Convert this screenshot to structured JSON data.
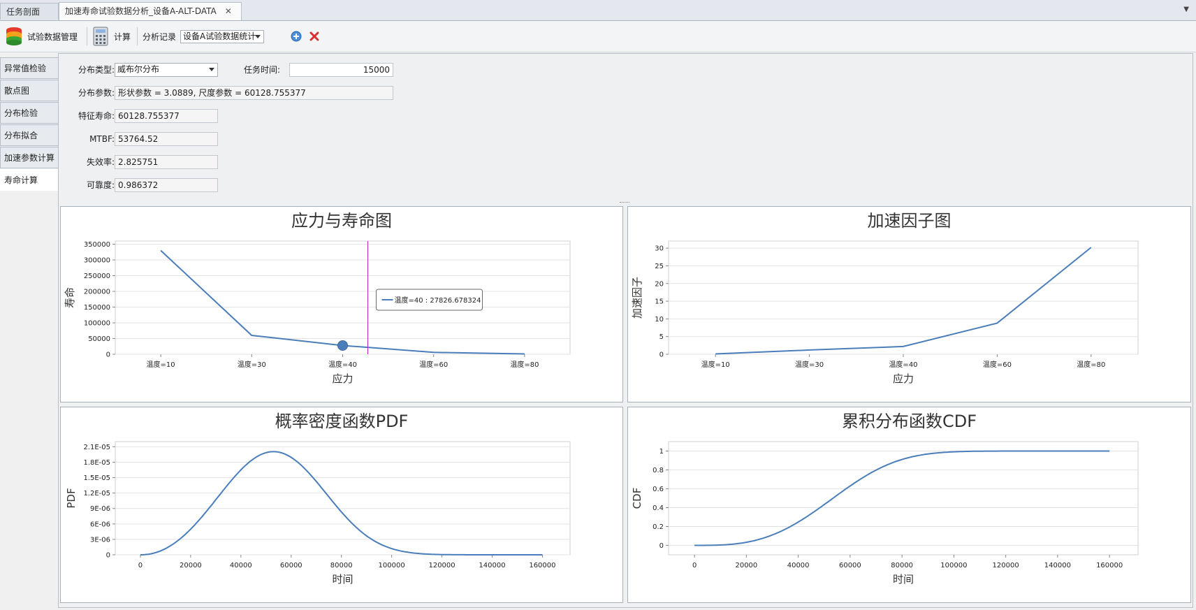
{
  "tabs": [
    {
      "label": "任务剖面"
    },
    {
      "label": "加速寿命试验数据分析_设备A-ALT-DATA"
    }
  ],
  "toolbar": {
    "data_mgmt_label": "试验数据管理",
    "calc_label": "计算",
    "record_label": "分析记录",
    "record_value": "设备A试验数据统计"
  },
  "nav": [
    {
      "label": "异常值检验"
    },
    {
      "label": "散点图"
    },
    {
      "label": "分布检验"
    },
    {
      "label": "分布拟合"
    },
    {
      "label": "加速参数计算"
    },
    {
      "label": "寿命计算"
    }
  ],
  "form": {
    "dist_type_label": "分布类型:",
    "dist_type_value": "威布尔分布",
    "task_time_label": "任务时间:",
    "task_time_value": "15000",
    "params_label": "分布参数:",
    "params_value": "形状参数 = 3.0889, 尺度参数 = 60128.755377",
    "char_life_label": "特征寿命:",
    "char_life_value": "60128.755377",
    "mtbf_label": "MTBF:",
    "mtbf_value": "53764.52",
    "failure_rate_label": "失效率:",
    "failure_rate_value": "2.825751",
    "reliability_label": "可靠度:",
    "reliability_value": "0.986372"
  },
  "accent": "#4a7ebb",
  "chart_data": [
    {
      "type": "line",
      "title": "应力与寿命图",
      "xlabel": "应力",
      "ylabel": "寿命",
      "categories": [
        "温度=10",
        "温度=30",
        "温度=40",
        "温度=60",
        "温度=80"
      ],
      "values": [
        330000,
        60000,
        27826.678324,
        6000,
        1000
      ],
      "ylim": [
        0,
        360000
      ],
      "yticks": [
        "0",
        "50000",
        "100000",
        "150000",
        "200000",
        "250000",
        "300000",
        "350000"
      ],
      "tooltip": "温度=40 : 27826.678324",
      "grid": true
    },
    {
      "type": "line",
      "title": "加速因子图",
      "xlabel": "应力",
      "ylabel": "加速因子",
      "categories": [
        "温度=10",
        "温度=30",
        "温度=40",
        "温度=60",
        "温度=80"
      ],
      "values": [
        0.1,
        1.2,
        2.2,
        8.8,
        30.2
      ],
      "ylim": [
        0,
        32
      ],
      "yticks": [
        "0",
        "5",
        "10",
        "15",
        "20",
        "25",
        "30"
      ],
      "grid": true
    },
    {
      "type": "line",
      "title": "概率密度函数PDF",
      "xlabel": "时间",
      "ylabel": "PDF",
      "xlim": [
        -10000,
        171000
      ],
      "ylim": [
        0,
        2.2e-05
      ],
      "xticks": [
        "0",
        "20000",
        "40000",
        "60000",
        "80000",
        "100000",
        "120000",
        "140000",
        "160000"
      ],
      "yticks": [
        "0",
        "3E-06",
        "6E-06",
        "9E-06",
        "1.2E-05",
        "1.5E-05",
        "1.8E-05",
        "2.1E-05"
      ],
      "weibull_shape": 3.0889,
      "weibull_scale": 60128.755377,
      "x_range": [
        0,
        160000
      ],
      "grid": true
    },
    {
      "type": "line",
      "title": "累积分布函数CDF",
      "xlabel": "时间",
      "ylabel": "CDF",
      "xlim": [
        -10000,
        171000
      ],
      "ylim": [
        -0.1,
        1.1
      ],
      "xticks": [
        "0",
        "20000",
        "40000",
        "60000",
        "80000",
        "100000",
        "120000",
        "140000",
        "160000"
      ],
      "yticks": [
        "0",
        "0.2",
        "0.4",
        "0.6",
        "0.8",
        "1"
      ],
      "weibull_shape": 3.0889,
      "weibull_scale": 60128.755377,
      "x_range": [
        0,
        160000
      ],
      "grid": true
    }
  ]
}
